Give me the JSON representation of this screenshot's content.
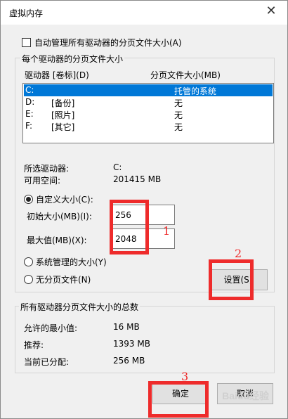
{
  "window": {
    "title": "虚拟内存",
    "close_glyph": "✕"
  },
  "auto_manage": {
    "label": "自动管理所有驱动器的分页文件大小(A)",
    "checked": false
  },
  "drives_group": {
    "title": "每个驱动器的分页文件大小",
    "col_drive": "驱动器 [卷标](D)",
    "col_size": "分页文件大小(MB)",
    "rows": [
      {
        "drive": "C:",
        "label": "",
        "size": "托管的系统"
      },
      {
        "drive": "D:",
        "label": "[备份]",
        "size": "无"
      },
      {
        "drive": "E:",
        "label": "[照片]",
        "size": "无"
      },
      {
        "drive": "F:",
        "label": "[其它]",
        "size": "无"
      }
    ],
    "selected_drive_label": "所选驱动器:",
    "selected_drive_value": "C:",
    "free_space_label": "可用空间:",
    "free_space_value": "201415 MB",
    "custom_size_label": "自定义大小(C):",
    "initial_size_label": "初始大小(MB)(I):",
    "initial_size_value": "256",
    "max_size_label": "最大值(MB)(X):",
    "max_size_value": "2048",
    "system_managed_label": "系统管理的大小(Y)",
    "no_paging_label": "无分页文件(N)",
    "set_button": "设置(S)"
  },
  "totals_group": {
    "title": "所有驱动器分页文件大小的总数",
    "min_allowed_label": "允许的最小值:",
    "min_allowed_value": "16 MB",
    "recommended_label": "推荐:",
    "recommended_value": "1393 MB",
    "current_label": "当前已分配:",
    "current_value": "256 MB"
  },
  "buttons": {
    "ok": "确定",
    "cancel": "取消"
  },
  "annotations": {
    "n1": "1",
    "n2": "2",
    "n3": "3"
  },
  "watermark": "Baidu经验",
  "colors": {
    "highlight": "#0078d7",
    "annotation_red": "#ee2b2b"
  }
}
